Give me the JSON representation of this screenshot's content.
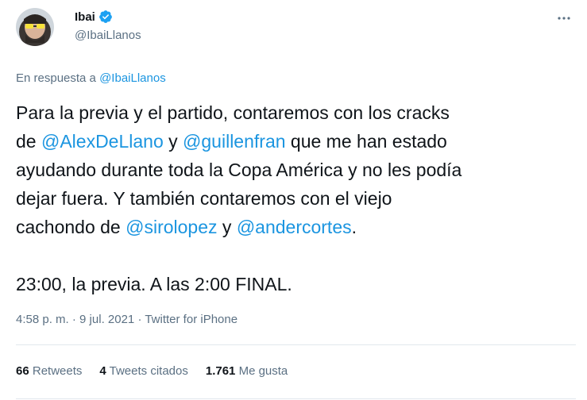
{
  "author": {
    "display_name": "Ibai",
    "handle": "@IbaiLlanos",
    "verified": true
  },
  "reply": {
    "prefix": "En respuesta a ",
    "to": "@IbaiLlanos"
  },
  "body": {
    "t1": "Para la previa y el partido, contaremos con los cracks\nde ",
    "m1": "@AlexDeLlano",
    "t2": " y ",
    "m2": "@guillenfran",
    "t3": " que me han estado\nayudando durante toda la Copa América y no les podía\ndejar fuera. Y también contaremos con el viejo\ncachondo de ",
    "m3": "@sirolopez",
    "t4": " y ",
    "m4": "@andercortes",
    "t5": ".\n\n23:00, la previa. A las 2:00 FINAL."
  },
  "meta": {
    "time": "4:58 p. m.",
    "sep1": " · ",
    "date": "9 jul. 2021",
    "sep2": " · ",
    "source": "Twitter for iPhone"
  },
  "stats": {
    "retweets_count": "66",
    "retweets_label": "Retweets",
    "quotes_count": "4",
    "quotes_label": "Tweets citados",
    "likes_count": "1.761",
    "likes_label": "Me gusta"
  },
  "colors": {
    "link": "#1b95e0",
    "secondary": "#5b7083",
    "text": "#0f1419",
    "divider": "#e1e8ed"
  },
  "icons": [
    "avatar-image",
    "verified-badge-icon",
    "more-options-icon"
  ]
}
